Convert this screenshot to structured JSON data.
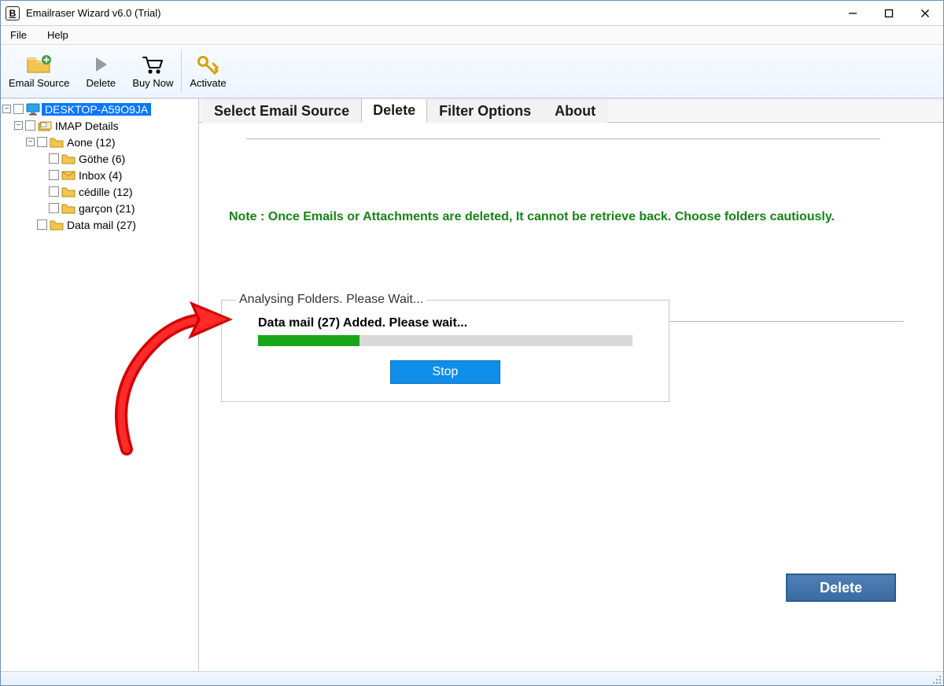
{
  "window_title": "Emailraser Wizard v6.0 (Trial)",
  "menubar": {
    "items": [
      "File",
      "Help"
    ]
  },
  "toolbar": {
    "email_source": "Email Source",
    "delete": "Delete",
    "buy_now": "Buy Now",
    "activate": "Activate"
  },
  "tree": {
    "root_label": "DESKTOP-A59O9JA",
    "imap_label": "IMAP Details",
    "folders": [
      "Aone (12)",
      "Göthe (6)",
      "Inbox (4)",
      "cédille (12)",
      "garçon (21)"
    ],
    "data_mail": "Data mail (27)"
  },
  "tabs": {
    "items": [
      "Select Email Source",
      "Delete",
      "Filter Options",
      "About"
    ],
    "active_index": 1
  },
  "note_text": "Note : Once Emails or Attachments are deleted, It cannot be retrieve back. Choose folders cautiously.",
  "dialog": {
    "legend": "Analysing Folders. Please Wait...",
    "status": "Data mail (27) Added. Please wait...",
    "progress_pct": 27,
    "stop_label": "Stop"
  },
  "delete_button_label": "Delete"
}
